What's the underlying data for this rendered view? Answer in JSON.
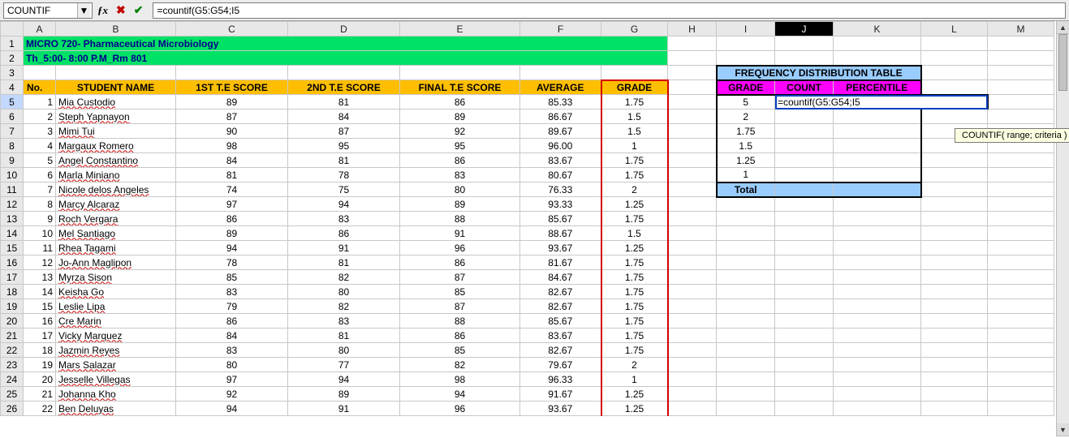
{
  "formula_bar": {
    "name_box": "COUNTIF",
    "formula": "=countif(G5:G54;I5",
    "tooltip": "COUNTIF( range; criteria )"
  },
  "chart_data": {
    "type": "table",
    "title": "MICRO 720- Pharmaceutical Microbiology",
    "subtitle": "Th_5:00- 8:00 P.M_Rm 801",
    "columns": [
      "No.",
      "STUDENT NAME",
      "1ST T.E SCORE",
      "2ND T.E SCORE",
      "FINAL T.E SCORE",
      "AVERAGE",
      "GRADE"
    ],
    "rows": [
      {
        "no": 1,
        "name": "Mia Custodio",
        "s1": 89,
        "s2": 81,
        "s3": 86,
        "avg": "85.33",
        "grade": "1.75"
      },
      {
        "no": 2,
        "name": "Steph Yapnayon",
        "s1": 87,
        "s2": 84,
        "s3": 89,
        "avg": "86.67",
        "grade": "1.5"
      },
      {
        "no": 3,
        "name": "Mimi Tui",
        "s1": 90,
        "s2": 87,
        "s3": 92,
        "avg": "89.67",
        "grade": "1.5"
      },
      {
        "no": 4,
        "name": "Margaux Romero",
        "s1": 98,
        "s2": 95,
        "s3": 95,
        "avg": "96.00",
        "grade": "1"
      },
      {
        "no": 5,
        "name": "Angel Constantino",
        "s1": 84,
        "s2": 81,
        "s3": 86,
        "avg": "83.67",
        "grade": "1.75"
      },
      {
        "no": 6,
        "name": "Marla Miniano",
        "s1": 81,
        "s2": 78,
        "s3": 83,
        "avg": "80.67",
        "grade": "1.75"
      },
      {
        "no": 7,
        "name": "Nicole delos Angeles",
        "s1": 74,
        "s2": 75,
        "s3": 80,
        "avg": "76.33",
        "grade": "2"
      },
      {
        "no": 8,
        "name": "Marcy Alcaraz",
        "s1": 97,
        "s2": 94,
        "s3": 89,
        "avg": "93.33",
        "grade": "1.25"
      },
      {
        "no": 9,
        "name": "Roch Vergara",
        "s1": 86,
        "s2": 83,
        "s3": 88,
        "avg": "85.67",
        "grade": "1.75"
      },
      {
        "no": 10,
        "name": "Mel Santiago",
        "s1": 89,
        "s2": 86,
        "s3": 91,
        "avg": "88.67",
        "grade": "1.5"
      },
      {
        "no": 11,
        "name": "Rhea Tagami",
        "s1": 94,
        "s2": 91,
        "s3": 96,
        "avg": "93.67",
        "grade": "1.25"
      },
      {
        "no": 12,
        "name": "Jo-Ann Maglipon",
        "s1": 78,
        "s2": 81,
        "s3": 86,
        "avg": "81.67",
        "grade": "1.75"
      },
      {
        "no": 13,
        "name": "Myrza Sison",
        "s1": 85,
        "s2": 82,
        "s3": 87,
        "avg": "84.67",
        "grade": "1.75"
      },
      {
        "no": 14,
        "name": "Keisha Go",
        "s1": 83,
        "s2": 80,
        "s3": 85,
        "avg": "82.67",
        "grade": "1.75"
      },
      {
        "no": 15,
        "name": "Leslie Lipa",
        "s1": 79,
        "s2": 82,
        "s3": 87,
        "avg": "82.67",
        "grade": "1.75"
      },
      {
        "no": 16,
        "name": "Cre Marin",
        "s1": 86,
        "s2": 83,
        "s3": 88,
        "avg": "85.67",
        "grade": "1.75"
      },
      {
        "no": 17,
        "name": "Vicky Marquez",
        "s1": 84,
        "s2": 81,
        "s3": 86,
        "avg": "83.67",
        "grade": "1.75"
      },
      {
        "no": 18,
        "name": "Jazmin Reyes",
        "s1": 83,
        "s2": 80,
        "s3": 85,
        "avg": "82.67",
        "grade": "1.75"
      },
      {
        "no": 19,
        "name": "Mars Salazar",
        "s1": 80,
        "s2": 77,
        "s3": 82,
        "avg": "79.67",
        "grade": "2"
      },
      {
        "no": 20,
        "name": "Jesselle Villegas",
        "s1": 97,
        "s2": 94,
        "s3": 98,
        "avg": "96.33",
        "grade": "1"
      },
      {
        "no": 21,
        "name": "Johanna Kho",
        "s1": 92,
        "s2": 89,
        "s3": 94,
        "avg": "91.67",
        "grade": "1.25"
      },
      {
        "no": 22,
        "name": "Ben Deluyas",
        "s1": 94,
        "s2": 91,
        "s3": 96,
        "avg": "93.67",
        "grade": "1.25"
      }
    ]
  },
  "freq_table": {
    "title": "FREQUENCY DISTRIBUTION TABLE",
    "headers": [
      "GRADE",
      "COUNT",
      "PERCENTILE"
    ],
    "rows": [
      {
        "grade": "5",
        "count": "=countif(G5:G54;I5",
        "pct": ""
      },
      {
        "grade": "2",
        "count": "",
        "pct": ""
      },
      {
        "grade": "1.75",
        "count": "",
        "pct": ""
      },
      {
        "grade": "1.5",
        "count": "",
        "pct": ""
      },
      {
        "grade": "1.25",
        "count": "",
        "pct": ""
      },
      {
        "grade": "1",
        "count": "",
        "pct": ""
      }
    ],
    "total_label": "Total"
  },
  "cols": [
    "",
    "A",
    "B",
    "C",
    "D",
    "E",
    "F",
    "G",
    "H",
    "I",
    "J",
    "K",
    "L",
    "M"
  ],
  "widths": [
    "28",
    "40",
    "148",
    "138",
    "138",
    "148",
    "100",
    "82",
    "60",
    "72",
    "72",
    "108",
    "82",
    "82"
  ],
  "active_cell": "J5"
}
